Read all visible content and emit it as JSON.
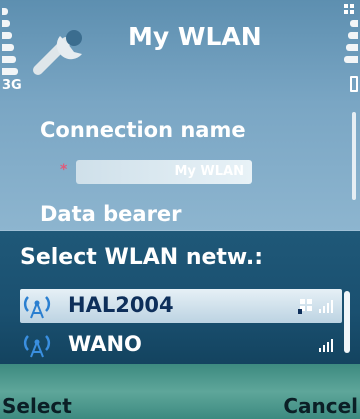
{
  "status": {
    "network_type": "3G"
  },
  "header": {
    "title": "My WLAN",
    "app_icon": "wrench-icon"
  },
  "settings": {
    "connection_name_label": "Connection name",
    "required_marker": "*",
    "connection_name_value": "My WLAN",
    "data_bearer_label": "Data bearer"
  },
  "popup": {
    "title": "Select WLAN netw.:",
    "items": [
      {
        "label": "HAL2004",
        "selected": true,
        "icons": [
          "wlan-icon",
          "secure-icon",
          "signal-strength-icon"
        ]
      },
      {
        "label": "WANO",
        "selected": false,
        "icons": [
          "wlan-icon",
          "signal-strength-icon"
        ]
      }
    ]
  },
  "softkeys": {
    "left": "Select",
    "right": "Cancel"
  },
  "colors": {
    "popup_bg": "#1a5070",
    "highlight": "#d6e6f0",
    "softkey_bar": "#4e9a8e",
    "required": "#e05a7a"
  }
}
